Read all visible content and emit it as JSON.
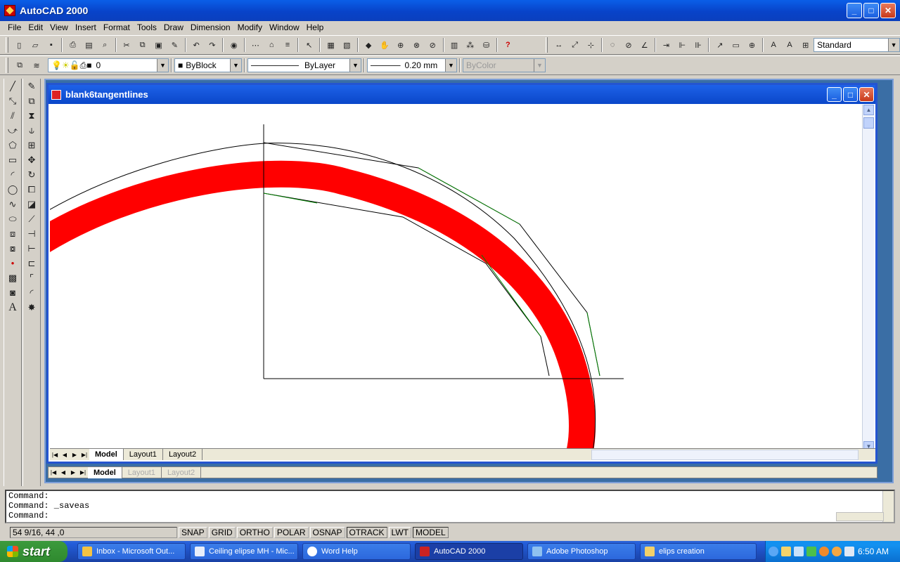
{
  "app": {
    "title": "AutoCAD 2000",
    "icon": "autocad-logo-icon"
  },
  "window_buttons": {
    "minimize": "_",
    "maximize": "□",
    "close": "✕"
  },
  "menu": [
    "File",
    "Edit",
    "View",
    "Insert",
    "Format",
    "Tools",
    "Draw",
    "Dimension",
    "Modify",
    "Window",
    "Help"
  ],
  "toolbar": {
    "dimstyle": "Standard",
    "layer": "0",
    "color": "ByBlock",
    "linetype": "ByLayer",
    "lineweight": "0.20 mm",
    "plotstyle": "ByColor"
  },
  "drawing_window": {
    "title": "blank6tangentlines"
  },
  "layout_tabs": [
    "Model",
    "Layout1",
    "Layout2"
  ],
  "outer_layout_tabs": [
    "Model",
    "Layout1",
    "Layout2"
  ],
  "command_lines": [
    "Command:",
    "Command: _saveas",
    "Command:"
  ],
  "status": {
    "coords": "54 9/16, 44     ,0",
    "toggles": [
      "SNAP",
      "GRID",
      "ORTHO",
      "POLAR",
      "OSNAP",
      "OTRACK",
      "LWT",
      "MODEL"
    ]
  },
  "colors": {
    "drawing_red": "#ff0000",
    "drawing_line": "#000000",
    "drawing_green": "#008000"
  },
  "taskbar": {
    "start": "start",
    "tasks": [
      {
        "label": "Inbox - Microsoft Out...",
        "icon": "outlook-icon"
      },
      {
        "label": "Ceiling elipse MH - Mic...",
        "icon": "word-doc-icon"
      },
      {
        "label": "Word Help",
        "icon": "help-icon"
      },
      {
        "label": "AutoCAD 2000",
        "icon": "autocad-icon"
      },
      {
        "label": "Adobe Photoshop",
        "icon": "photoshop-icon"
      },
      {
        "label": "elips creation",
        "icon": "folder-icon"
      }
    ],
    "clock": "6:50 AM"
  }
}
